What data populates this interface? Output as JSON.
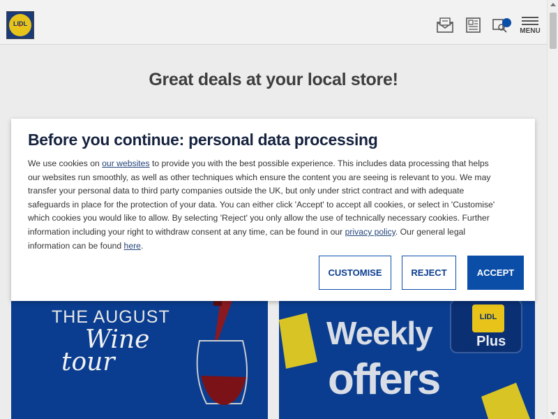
{
  "header": {
    "logo_text": "LIDL",
    "menu_label": "MENU",
    "icons": [
      "newsletter-icon",
      "leaflet-icon",
      "store-finder-icon",
      "menu-icon"
    ]
  },
  "main": {
    "headline": "Great deals at your local store!"
  },
  "promos": {
    "wine": {
      "title": "THE AUGUST",
      "script1": "Wine",
      "script2": "tour"
    },
    "weekly": {
      "line1": "Weekly",
      "line2": "offers",
      "plus_logo": "LIDL",
      "plus_label": "Plus"
    }
  },
  "cookie_dialog": {
    "title": "Before you continue: personal data processing",
    "text_1": "We use cookies on ",
    "link_websites": "our websites",
    "text_2": " to provide you with the best possible experience. This includes data processing that helps our websites run smoothly, as well as other techniques which ensure the content you are seeing is relevant to you. We may transfer your personal data to third party companies outside the UK, but only under strict contract and with adequate safeguards in place for the protection of your data. You can either click 'Accept' to accept all cookies, or select in 'Customise' which cookies you would like to allow. By selecting 'Reject' you only allow the use of technically necessary cookies. Further information including your right to withdraw consent at any time, can be found in our ",
    "link_privacy": "privacy policy",
    "text_3": ". Our general legal information can be found ",
    "link_here": "here",
    "text_4": ".",
    "customise_label": "CUSTOMISE",
    "reject_label": "REJECT",
    "accept_label": "ACCEPT"
  },
  "colors": {
    "brand_blue": "#0a4ea8",
    "brand_yellow": "#e8c31a",
    "title_navy": "#16233f"
  }
}
